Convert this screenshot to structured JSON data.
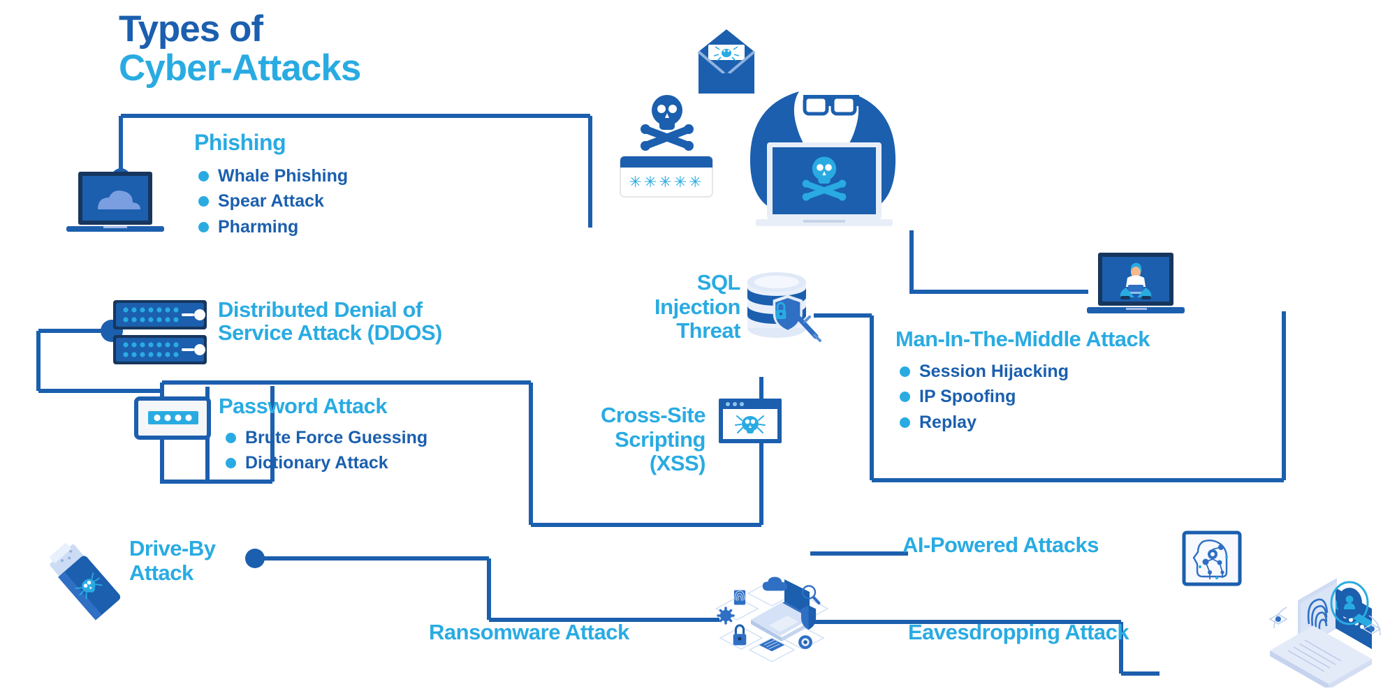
{
  "title": {
    "line1": "Types of",
    "line2": "Cyber-Attacks"
  },
  "colors": {
    "dark_blue": "#1b5fae",
    "light_blue": "#29abe2",
    "navy": "#1a3a5c",
    "line": "#1b5fae",
    "background": "#ffffff"
  },
  "nodes": {
    "phishing": {
      "heading": "Phishing",
      "items": [
        "Whale Phishing",
        "Spear Attack",
        "Pharming"
      ],
      "icon": "laptop-cloud-icon"
    },
    "ddos": {
      "heading_line1": "Distributed Denial of",
      "heading_line2": "Service Attack (DDOS)",
      "icon": "server-rack-icon"
    },
    "password_attack": {
      "heading": "Password Attack",
      "items": [
        "Brute Force Guessing",
        "Dictionary Attack"
      ],
      "icon": "password-field-icon"
    },
    "sql_injection": {
      "heading_line1": "SQL",
      "heading_line2": "Injection",
      "heading_line3": "Threat",
      "icon": "database-shield-syringe-icon"
    },
    "xss": {
      "heading_line1": "Cross-Site",
      "heading_line2": "Scripting",
      "heading_line3": "(XSS)",
      "icon": "browser-bug-icon"
    },
    "mitm": {
      "heading": "Man-In-The-Middle Attack",
      "items": [
        "Session Hijacking",
        "IP Spoofing",
        "Replay"
      ],
      "icon": "laptop-person-icon"
    },
    "drive_by": {
      "heading_line1": "Drive-By",
      "heading_line2": "Attack",
      "icon": "usb-bug-icon"
    },
    "ransomware": {
      "heading": "Ransomware Attack",
      "icon": "isometric-laptop-security-icon"
    },
    "ai_powered": {
      "heading": "AI-Powered Attacks",
      "icon": "ai-head-circuit-icon"
    },
    "eavesdropping": {
      "heading": "Eavesdropping Attack",
      "icon": "isometric-laptop-fingerprint-icon"
    }
  },
  "hacker_scene": {
    "password_mask": "✳✳✳✳✳",
    "icons": [
      "envelope-bug-icon",
      "skull-crossbones-icon",
      "password-bar-icon",
      "hooded-hacker-icon",
      "laptop-skull-icon"
    ]
  }
}
